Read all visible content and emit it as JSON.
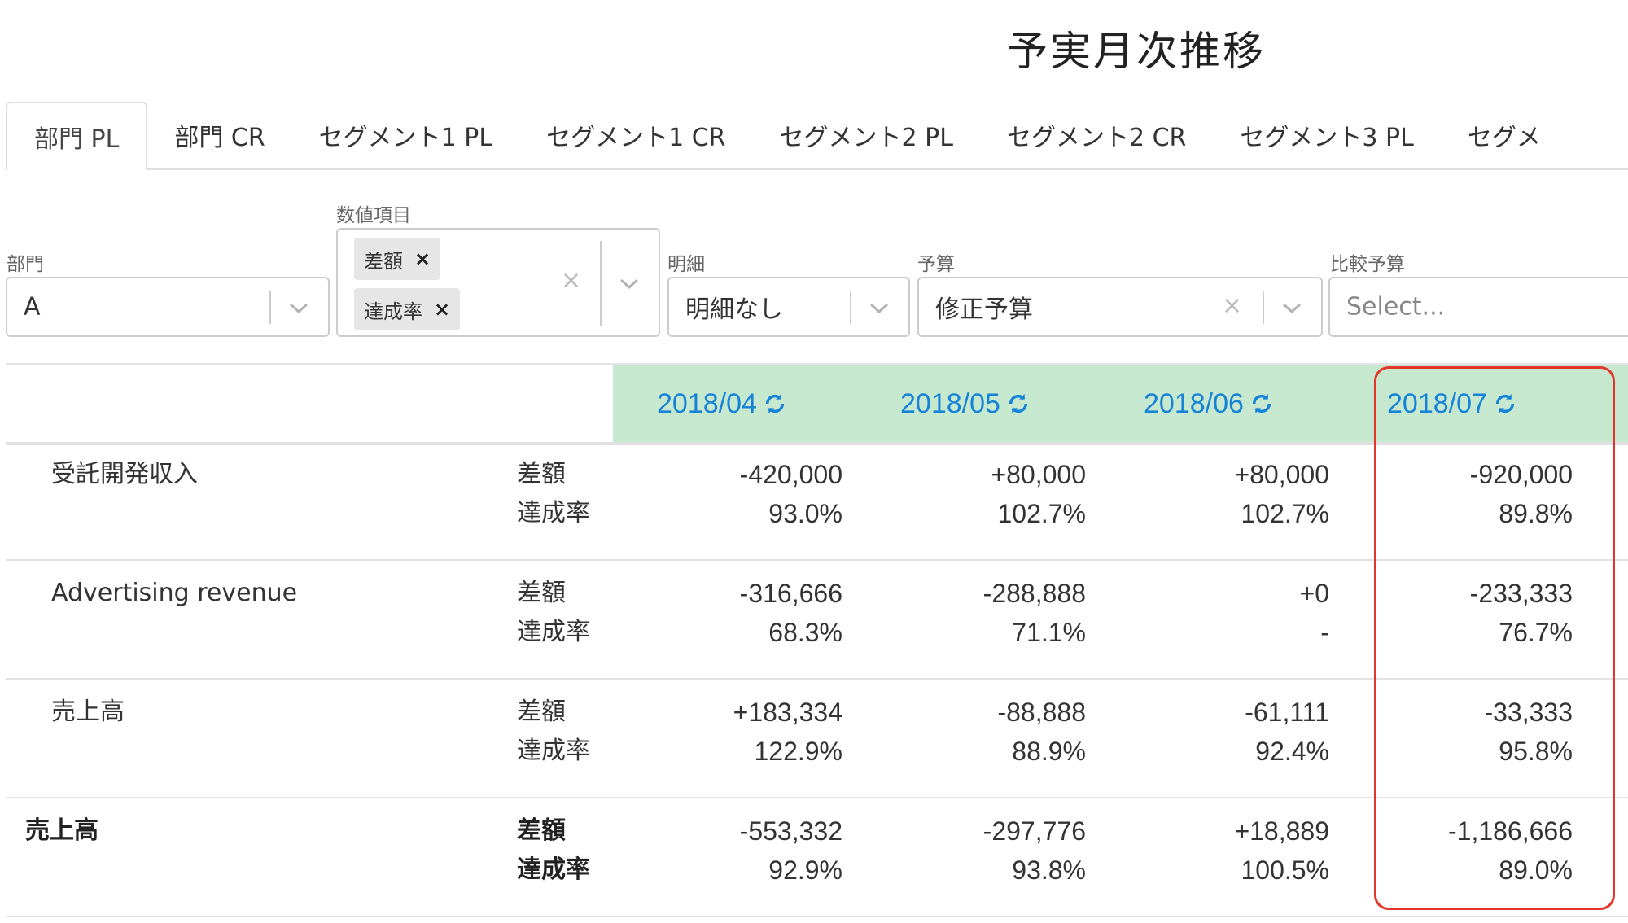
{
  "page": {
    "title": "予実月次推移"
  },
  "tabs": [
    {
      "label": "部門 PL",
      "active": true
    },
    {
      "label": "部門 CR"
    },
    {
      "label": "セグメント1 PL"
    },
    {
      "label": "セグメント1 CR"
    },
    {
      "label": "セグメント2 PL"
    },
    {
      "label": "セグメント2 CR"
    },
    {
      "label": "セグメント3 PL"
    },
    {
      "label": "セグメ"
    }
  ],
  "filters": {
    "department": {
      "label": "部門",
      "value": "A"
    },
    "metrics": {
      "label": "数値項目",
      "tags": [
        "差額",
        "達成率"
      ]
    },
    "detail": {
      "label": "明細",
      "value": "明細なし"
    },
    "budget": {
      "label": "予算",
      "value": "修正予算"
    },
    "compare_budget": {
      "label": "比較予算",
      "placeholder": "Select..."
    }
  },
  "table": {
    "months": [
      "2018/04",
      "2018/05",
      "2018/06",
      "2018/07"
    ],
    "rows": [
      {
        "name": "受託開発収入",
        "metrics": [
          "差額",
          "達成率"
        ],
        "values": [
          [
            "-420,000",
            "93.0%"
          ],
          [
            "+80,000",
            "102.7%"
          ],
          [
            "+80,000",
            "102.7%"
          ],
          [
            "-920,000",
            "89.8%"
          ]
        ]
      },
      {
        "name": "Advertising revenue",
        "metrics": [
          "差額",
          "達成率"
        ],
        "values": [
          [
            "-316,666",
            "68.3%"
          ],
          [
            "-288,888",
            "71.1%"
          ],
          [
            "+0",
            "-"
          ],
          [
            "-233,333",
            "76.7%"
          ]
        ]
      },
      {
        "name": "売上高",
        "metrics": [
          "差額",
          "達成率"
        ],
        "values": [
          [
            "+183,334",
            "122.9%"
          ],
          [
            "-88,888",
            "88.9%"
          ],
          [
            "-61,111",
            "92.4%"
          ],
          [
            "-33,333",
            "95.8%"
          ]
        ]
      },
      {
        "name": "売上高",
        "bold": true,
        "metrics": [
          "差額",
          "達成率"
        ],
        "values": [
          [
            "-553,332",
            "92.9%"
          ],
          [
            "-297,776",
            "93.8%"
          ],
          [
            "+18,889",
            "100.5%"
          ],
          [
            "-1,186,666",
            "89.0%"
          ]
        ]
      }
    ]
  },
  "colors": {
    "accent": "#1683d8",
    "header_bg": "#c5e8cf",
    "highlight": "#e3352a"
  },
  "icons": {
    "refresh": "refresh-icon",
    "chevron": "chevron-down-icon",
    "clear": "clear-icon"
  }
}
